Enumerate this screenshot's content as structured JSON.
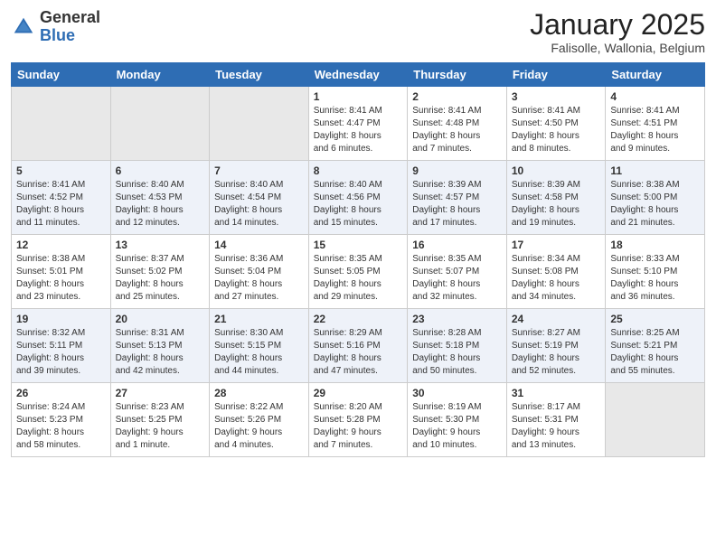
{
  "header": {
    "logo_general": "General",
    "logo_blue": "Blue",
    "month_title": "January 2025",
    "subtitle": "Falisolle, Wallonia, Belgium"
  },
  "days_of_week": [
    "Sunday",
    "Monday",
    "Tuesday",
    "Wednesday",
    "Thursday",
    "Friday",
    "Saturday"
  ],
  "weeks": [
    [
      {
        "day": "",
        "info": ""
      },
      {
        "day": "",
        "info": ""
      },
      {
        "day": "",
        "info": ""
      },
      {
        "day": "1",
        "info": "Sunrise: 8:41 AM\nSunset: 4:47 PM\nDaylight: 8 hours\nand 6 minutes."
      },
      {
        "day": "2",
        "info": "Sunrise: 8:41 AM\nSunset: 4:48 PM\nDaylight: 8 hours\nand 7 minutes."
      },
      {
        "day": "3",
        "info": "Sunrise: 8:41 AM\nSunset: 4:50 PM\nDaylight: 8 hours\nand 8 minutes."
      },
      {
        "day": "4",
        "info": "Sunrise: 8:41 AM\nSunset: 4:51 PM\nDaylight: 8 hours\nand 9 minutes."
      }
    ],
    [
      {
        "day": "5",
        "info": "Sunrise: 8:41 AM\nSunset: 4:52 PM\nDaylight: 8 hours\nand 11 minutes."
      },
      {
        "day": "6",
        "info": "Sunrise: 8:40 AM\nSunset: 4:53 PM\nDaylight: 8 hours\nand 12 minutes."
      },
      {
        "day": "7",
        "info": "Sunrise: 8:40 AM\nSunset: 4:54 PM\nDaylight: 8 hours\nand 14 minutes."
      },
      {
        "day": "8",
        "info": "Sunrise: 8:40 AM\nSunset: 4:56 PM\nDaylight: 8 hours\nand 15 minutes."
      },
      {
        "day": "9",
        "info": "Sunrise: 8:39 AM\nSunset: 4:57 PM\nDaylight: 8 hours\nand 17 minutes."
      },
      {
        "day": "10",
        "info": "Sunrise: 8:39 AM\nSunset: 4:58 PM\nDaylight: 8 hours\nand 19 minutes."
      },
      {
        "day": "11",
        "info": "Sunrise: 8:38 AM\nSunset: 5:00 PM\nDaylight: 8 hours\nand 21 minutes."
      }
    ],
    [
      {
        "day": "12",
        "info": "Sunrise: 8:38 AM\nSunset: 5:01 PM\nDaylight: 8 hours\nand 23 minutes."
      },
      {
        "day": "13",
        "info": "Sunrise: 8:37 AM\nSunset: 5:02 PM\nDaylight: 8 hours\nand 25 minutes."
      },
      {
        "day": "14",
        "info": "Sunrise: 8:36 AM\nSunset: 5:04 PM\nDaylight: 8 hours\nand 27 minutes."
      },
      {
        "day": "15",
        "info": "Sunrise: 8:35 AM\nSunset: 5:05 PM\nDaylight: 8 hours\nand 29 minutes."
      },
      {
        "day": "16",
        "info": "Sunrise: 8:35 AM\nSunset: 5:07 PM\nDaylight: 8 hours\nand 32 minutes."
      },
      {
        "day": "17",
        "info": "Sunrise: 8:34 AM\nSunset: 5:08 PM\nDaylight: 8 hours\nand 34 minutes."
      },
      {
        "day": "18",
        "info": "Sunrise: 8:33 AM\nSunset: 5:10 PM\nDaylight: 8 hours\nand 36 minutes."
      }
    ],
    [
      {
        "day": "19",
        "info": "Sunrise: 8:32 AM\nSunset: 5:11 PM\nDaylight: 8 hours\nand 39 minutes."
      },
      {
        "day": "20",
        "info": "Sunrise: 8:31 AM\nSunset: 5:13 PM\nDaylight: 8 hours\nand 42 minutes."
      },
      {
        "day": "21",
        "info": "Sunrise: 8:30 AM\nSunset: 5:15 PM\nDaylight: 8 hours\nand 44 minutes."
      },
      {
        "day": "22",
        "info": "Sunrise: 8:29 AM\nSunset: 5:16 PM\nDaylight: 8 hours\nand 47 minutes."
      },
      {
        "day": "23",
        "info": "Sunrise: 8:28 AM\nSunset: 5:18 PM\nDaylight: 8 hours\nand 50 minutes."
      },
      {
        "day": "24",
        "info": "Sunrise: 8:27 AM\nSunset: 5:19 PM\nDaylight: 8 hours\nand 52 minutes."
      },
      {
        "day": "25",
        "info": "Sunrise: 8:25 AM\nSunset: 5:21 PM\nDaylight: 8 hours\nand 55 minutes."
      }
    ],
    [
      {
        "day": "26",
        "info": "Sunrise: 8:24 AM\nSunset: 5:23 PM\nDaylight: 8 hours\nand 58 minutes."
      },
      {
        "day": "27",
        "info": "Sunrise: 8:23 AM\nSunset: 5:25 PM\nDaylight: 9 hours\nand 1 minute."
      },
      {
        "day": "28",
        "info": "Sunrise: 8:22 AM\nSunset: 5:26 PM\nDaylight: 9 hours\nand 4 minutes."
      },
      {
        "day": "29",
        "info": "Sunrise: 8:20 AM\nSunset: 5:28 PM\nDaylight: 9 hours\nand 7 minutes."
      },
      {
        "day": "30",
        "info": "Sunrise: 8:19 AM\nSunset: 5:30 PM\nDaylight: 9 hours\nand 10 minutes."
      },
      {
        "day": "31",
        "info": "Sunrise: 8:17 AM\nSunset: 5:31 PM\nDaylight: 9 hours\nand 13 minutes."
      },
      {
        "day": "",
        "info": ""
      }
    ]
  ]
}
